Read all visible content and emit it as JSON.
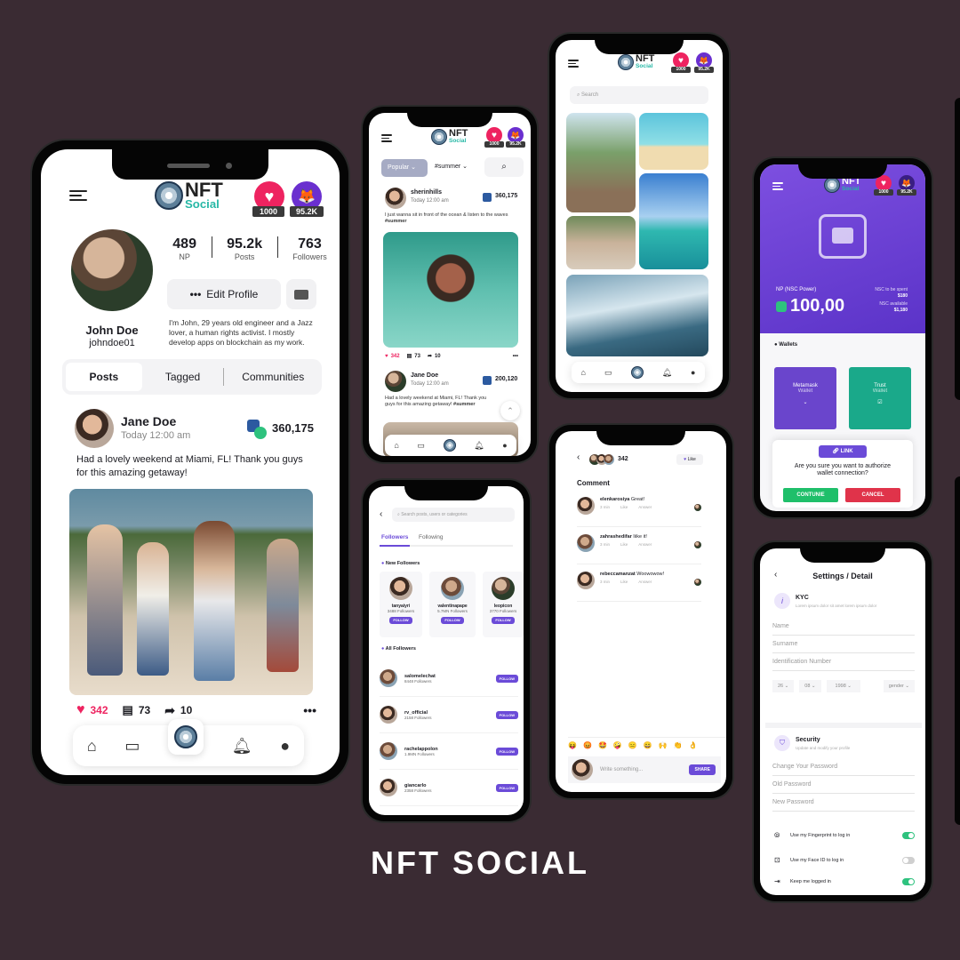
{
  "title": "NFT SOCIAL",
  "brand": {
    "name": "NFT",
    "sub": "Social",
    "accent": "#27b8a6",
    "primary": "#6b4bd8",
    "heart": "#ee2360"
  },
  "badges": {
    "hearts": "1000",
    "fox": "95.2K"
  },
  "profile": {
    "stats": [
      {
        "value": "489",
        "label": "NP"
      },
      {
        "value": "95.2k",
        "label": "Posts"
      },
      {
        "value": "763",
        "label": "Followers"
      }
    ],
    "edit_label": "Edit Profile",
    "name": "John Doe",
    "handle": "johndoe01",
    "bio": "I'm John, 29 years old engineer and a Jazz lover, a human rights activist. I mostly develop apps on blockchain as my work.",
    "tabs": [
      "Posts",
      "Tagged",
      "Communities"
    ],
    "post": {
      "author": "Jane Doe",
      "time": "Today 12:00  am",
      "nft_value": "360,175",
      "text": "Had a lovely weekend at Miami, FL! Thank you guys for this amazing getaway!",
      "likes": "342",
      "comments": "73",
      "shares": "10"
    }
  },
  "feed": {
    "filter": "Popular",
    "tag": "#summer",
    "posts": [
      {
        "author": "sherinhills",
        "time": "Today 12:00 am",
        "value": "360,175",
        "text": "I just wanna sit in front of the ocean & listen to the waves",
        "tag": "#summer",
        "likes": "342",
        "comments": "73",
        "shares": "10"
      },
      {
        "author": "Jane Doe",
        "time": "Today 12:00 am",
        "value": "200,120",
        "text": "Had a lovely weekend at Miami, FL! Thank you guys for this amazing getaway!",
        "tag": "#summer"
      }
    ]
  },
  "explore": {
    "search_placeholder": "Search"
  },
  "followers": {
    "search_placeholder": "Search posts, users or categories",
    "tabs": [
      "Followers",
      "Following"
    ],
    "new_title": "New Followers",
    "new": [
      {
        "name": "tanyaiyri",
        "count": "3488 Followers"
      },
      {
        "name": "valentinapape",
        "count": "5.7MN Followers"
      },
      {
        "name": "leopicon",
        "count": "3770 Followers"
      }
    ],
    "all_title": "All Followers",
    "follow_label": "FOLLOW",
    "all": [
      {
        "name": "salomelechat",
        "count": "8448 Followers"
      },
      {
        "name": "rv_official",
        "count": "2158 Followers"
      },
      {
        "name": "rachelappolon",
        "count": "1.9MN Followers"
      },
      {
        "name": "giancarlo",
        "count": "2358 Followers"
      }
    ]
  },
  "comments": {
    "count": "342",
    "like_label": "Like",
    "title": "Comment",
    "items": [
      {
        "user": "elenkarosiya",
        "text": "Great!",
        "time": "3 min",
        "like": "Like",
        "answer": "Answer"
      },
      {
        "user": "zahrashedifar",
        "text": "Iiike it!",
        "time": "3 min",
        "like": "Like",
        "answer": "Answer"
      },
      {
        "user": "rebeccamanzat",
        "text": "Woowowow!",
        "time": "3 min",
        "like": "Like",
        "answer": "Answer"
      }
    ],
    "emojis": [
      "😝",
      "😡",
      "🤩",
      "🤪",
      "😑",
      "😄",
      "🙌",
      "👏",
      "👌"
    ],
    "input_placeholder": "Write something...",
    "share_label": "SHARE"
  },
  "wallet": {
    "np_label": "NP (NSC Power)",
    "np_value": "100,00",
    "spent_label": "NSC to be spent",
    "spent_value": "$180",
    "avail_label": "NSC available",
    "avail_value": "$1,180",
    "wallets_title": "Wallets",
    "metamask": "Metamask",
    "metamask_sub": "Wallet",
    "trust": "Trust",
    "trust_sub": "Wallet",
    "link_label": "LINK",
    "question": "Are you sure you want to authorize wallet connection?",
    "continue_label": "CONTUNIE",
    "cancel_label": "CANCEL"
  },
  "settings": {
    "title": "Settings / Detail",
    "kyc_title": "KYC",
    "kyc_sub": "Lorem ipsum dolor sit amet lorem ipsum dolor",
    "fields": [
      "Name",
      "Surname",
      "Identification Number"
    ],
    "dob": [
      "26",
      "08",
      "1998"
    ],
    "gender": "gender",
    "security_title": "Security",
    "security_sub": "Update and modify your profile",
    "pw_fields": [
      "Change Your Password",
      "Old Password",
      "New Password"
    ],
    "toggles": [
      {
        "label": "Use my Fingerprint to log in",
        "state": "on"
      },
      {
        "label": "Use my Face ID to log in",
        "state": "off"
      },
      {
        "label": "Keep me logged in",
        "state": "on"
      }
    ]
  }
}
